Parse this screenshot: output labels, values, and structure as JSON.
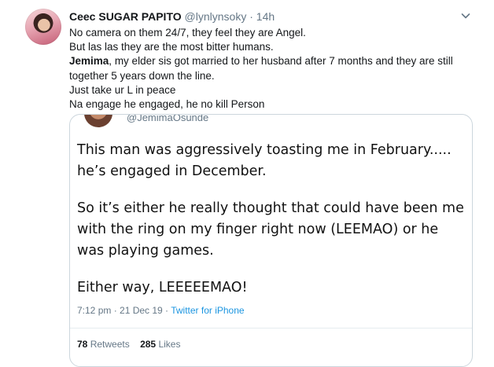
{
  "tweet": {
    "display_name": "Ceec SUGAR PAPITO",
    "handle": "@lynlynsoky",
    "separator": "·",
    "time": "14h",
    "lines": [
      "No camera on them 24/7, they feel they are Angel.",
      "But las las they are the most bitter humans.",
      "my elder sis got married to her husband after 7 months and they are still",
      "together 5 years down the line.",
      "Just take ur L in peace",
      "Na engage he engaged, he no kill Person"
    ],
    "bold_word": "Jemima",
    "bold_suffix": ", "
  },
  "quoted": {
    "handle": "@JemimaOsunde",
    "paragraphs": [
      "This man was aggressively toasting me in February.....",
      "he’s engaged in December.",
      "So it’s either he really thought that could have been me",
      "with the ring on my finger right now (LEEMAO) or he",
      "was playing games.",
      "Either way, LEEEEEMAO!"
    ],
    "timestamp": "7:12 pm · 21 Dec 19 · ",
    "source": "Twitter for iPhone",
    "retweets_count": "78",
    "retweets_label": "Retweets",
    "likes_count": "285",
    "likes_label": "Likes"
  },
  "icons": {
    "caret": "chevron-down-icon"
  },
  "colors": {
    "secondary_text": "#657786",
    "link": "#1b95e0",
    "border": "#ccd6dd"
  }
}
